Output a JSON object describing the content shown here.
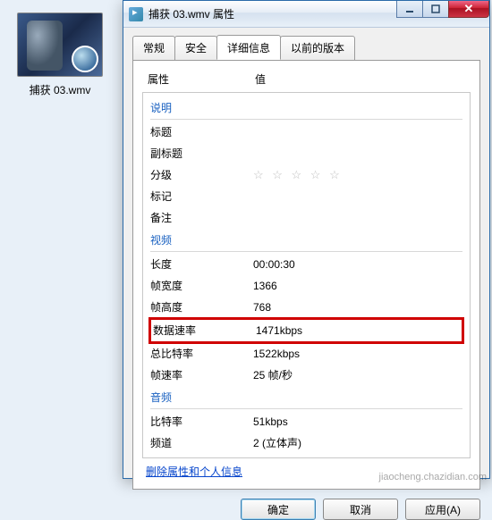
{
  "file": {
    "name": "捕获 03.wmv"
  },
  "dialog": {
    "title": "捕获 03.wmv 属性",
    "tabs": {
      "general": "常规",
      "security": "安全",
      "details": "详细信息",
      "previous": "以前的版本"
    },
    "columns": {
      "prop": "属性",
      "value": "值"
    },
    "sections": {
      "description": "说明",
      "video": "视频",
      "audio": "音频"
    },
    "rows": {
      "title": "标题",
      "subtitle": "副标题",
      "rating": "分级",
      "rating_val": "☆ ☆ ☆ ☆ ☆",
      "tags": "标记",
      "comments": "备注",
      "length": "长度",
      "length_val": "00:00:30",
      "frame_w": "帧宽度",
      "frame_w_val": "1366",
      "frame_h": "帧高度",
      "frame_h_val": "768",
      "data_rate": "数据速率",
      "data_rate_val": "1471kbps",
      "total_rate": "总比特率",
      "total_rate_val": "1522kbps",
      "frame_rate": "帧速率",
      "frame_rate_val": "25 帧/秒",
      "bit_rate": "比特率",
      "bit_rate_val": "51kbps",
      "channels": "频道",
      "channels_val": "2 (立体声)"
    },
    "link": "删除属性和个人信息",
    "buttons": {
      "ok": "确定",
      "cancel": "取消",
      "apply": "应用(A)"
    }
  },
  "watermark": "jiaocheng.chazidian.com"
}
